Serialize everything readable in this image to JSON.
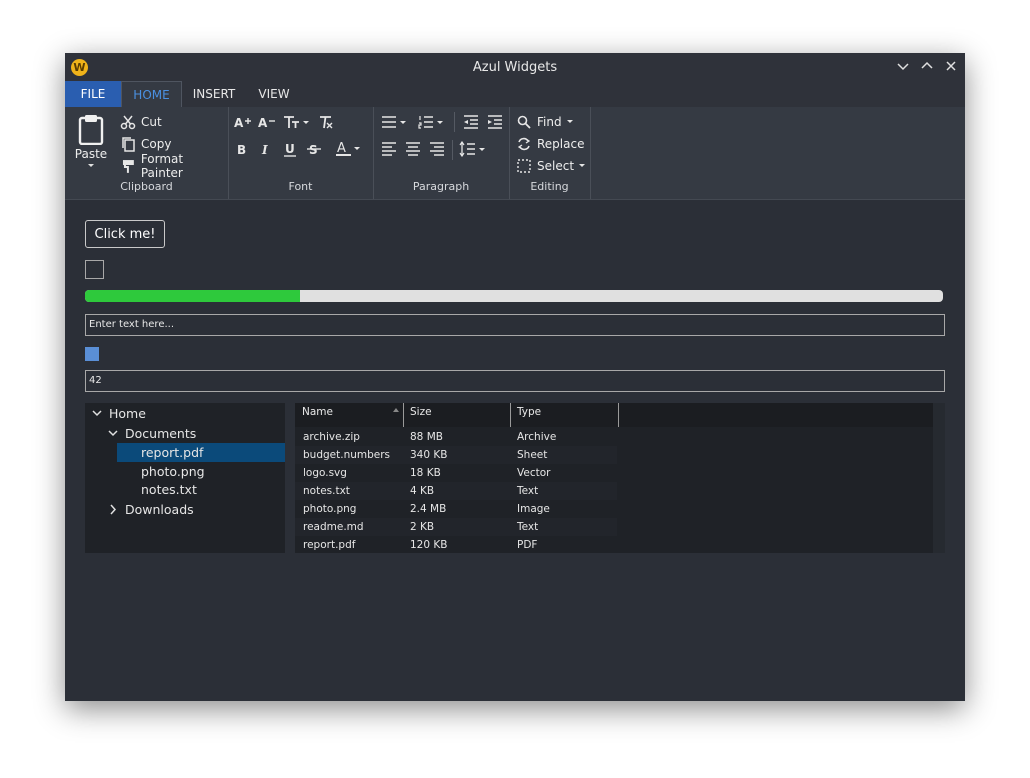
{
  "window": {
    "title": "Azul Widgets",
    "logo_letter": "W"
  },
  "menu": {
    "file": "FILE",
    "home": "HOME",
    "insert": "INSERT",
    "view": "VIEW"
  },
  "ribbon": {
    "clipboard": {
      "label": "Clipboard",
      "paste": "Paste",
      "cut": "Cut",
      "copy": "Copy",
      "format_painter": "Format Painter"
    },
    "font": {
      "label": "Font"
    },
    "paragraph": {
      "label": "Paragraph"
    },
    "editing": {
      "label": "Editing",
      "find": "Find",
      "replace": "Replace",
      "select": "Select"
    }
  },
  "controls": {
    "button_label": "Click me!",
    "progress_fraction": 0.25,
    "text_input_placeholder": "Enter text here...",
    "number_value": "42"
  },
  "tree": {
    "home": "Home",
    "documents": "Documents",
    "files": [
      "report.pdf",
      "photo.png",
      "notes.txt"
    ],
    "downloads": "Downloads",
    "selected": "report.pdf"
  },
  "table": {
    "columns": [
      "Name",
      "Size",
      "Type"
    ],
    "rows": [
      [
        "archive.zip",
        "88 MB",
        "Archive"
      ],
      [
        "budget.numbers",
        "340 KB",
        "Sheet"
      ],
      [
        "logo.svg",
        "18 KB",
        "Vector"
      ],
      [
        "notes.txt",
        "4 KB",
        "Text"
      ],
      [
        "photo.png",
        "2.4 MB",
        "Image"
      ],
      [
        "readme.md",
        "2 KB",
        "Text"
      ],
      [
        "report.pdf",
        "120 KB",
        "PDF"
      ]
    ]
  },
  "colors": {
    "accent": "#4a90e2",
    "file_tab": "#2a5eb0",
    "progress": "#2ec93c",
    "selection": "#0b4a7a"
  }
}
